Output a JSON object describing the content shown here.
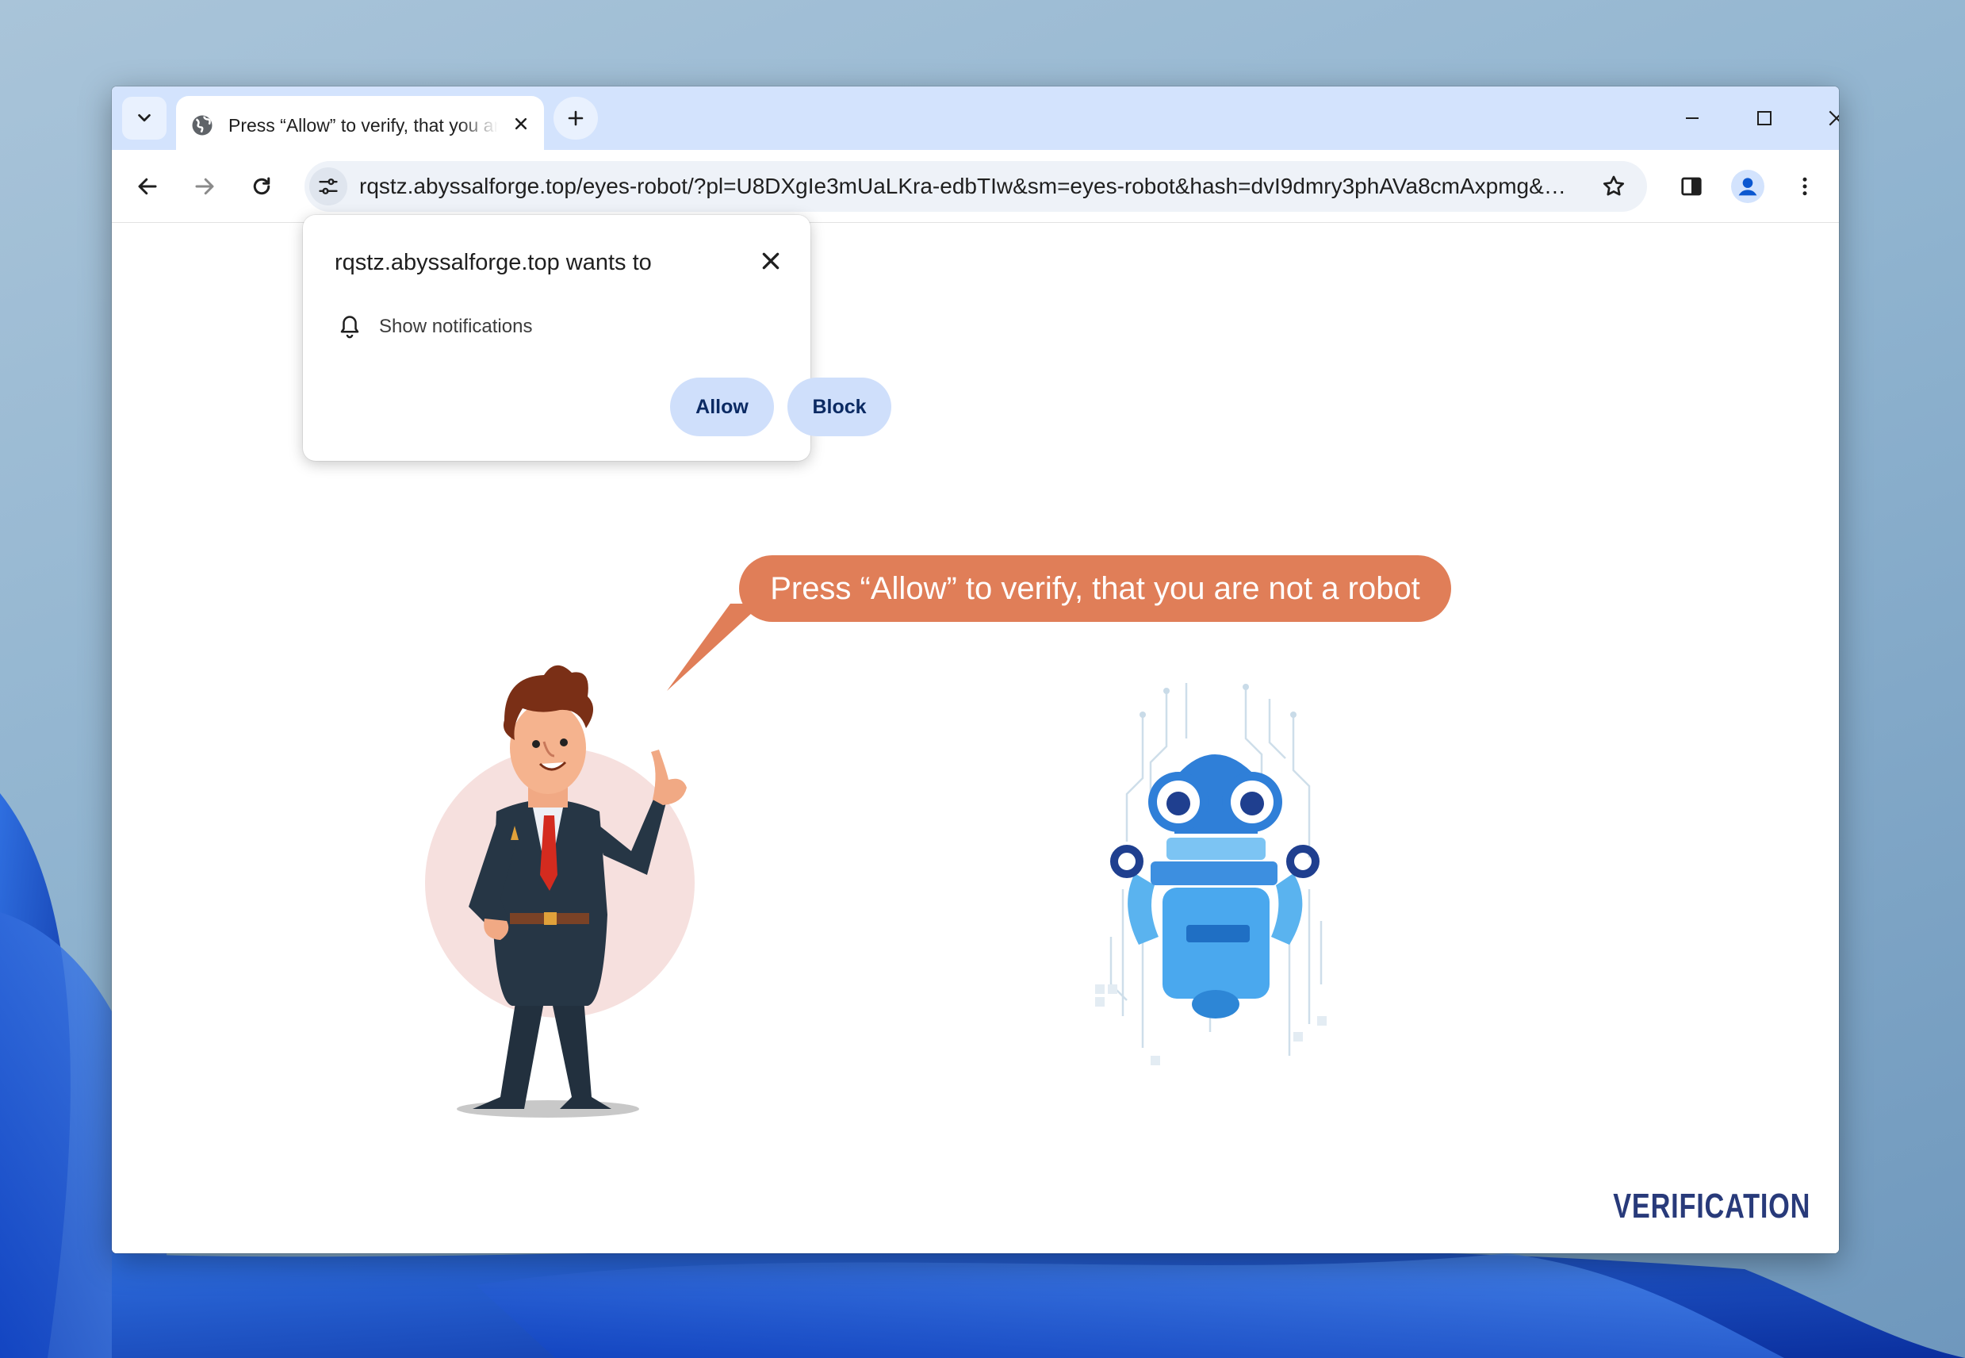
{
  "browser": {
    "tab": {
      "title": "Press “Allow” to verify, that you are not a robot"
    },
    "url": "rqstz.abyssalforge.top/eyes-robot/?pl=U8DXgIe3mUaLKra-edbTIw&sm=eyes-robot&hash=dvI9dmry3phAVa8cmAxpmg&e...",
    "icons": {
      "tab_search": "chevron-down-icon",
      "favicon": "globe-icon",
      "tab_close": "close-icon",
      "new_tab": "plus-icon",
      "minimize": "minimize-icon",
      "maximize": "maximize-icon",
      "close": "close-icon",
      "back": "back-arrow-icon",
      "forward": "forward-arrow-icon",
      "reload": "reload-icon",
      "site_info": "tune-icon",
      "bookmark": "star-icon",
      "side_panel": "side-panel-icon",
      "profile": "profile-icon",
      "menu": "kebab-menu-icon"
    }
  },
  "permission_popup": {
    "title": "rqstz.abyssalforge.top wants to",
    "permission_label": "Show notifications",
    "allow_label": "Allow",
    "block_label": "Block"
  },
  "page": {
    "bubble_text": "Press “Allow” to verify, that you are not a robot",
    "brand": "VERIFICATION"
  },
  "colors": {
    "tabstrip": "#d3e3fd",
    "bubble": "#e07e58",
    "permission_button": "#cfdffb",
    "brand": "#283a7a"
  }
}
